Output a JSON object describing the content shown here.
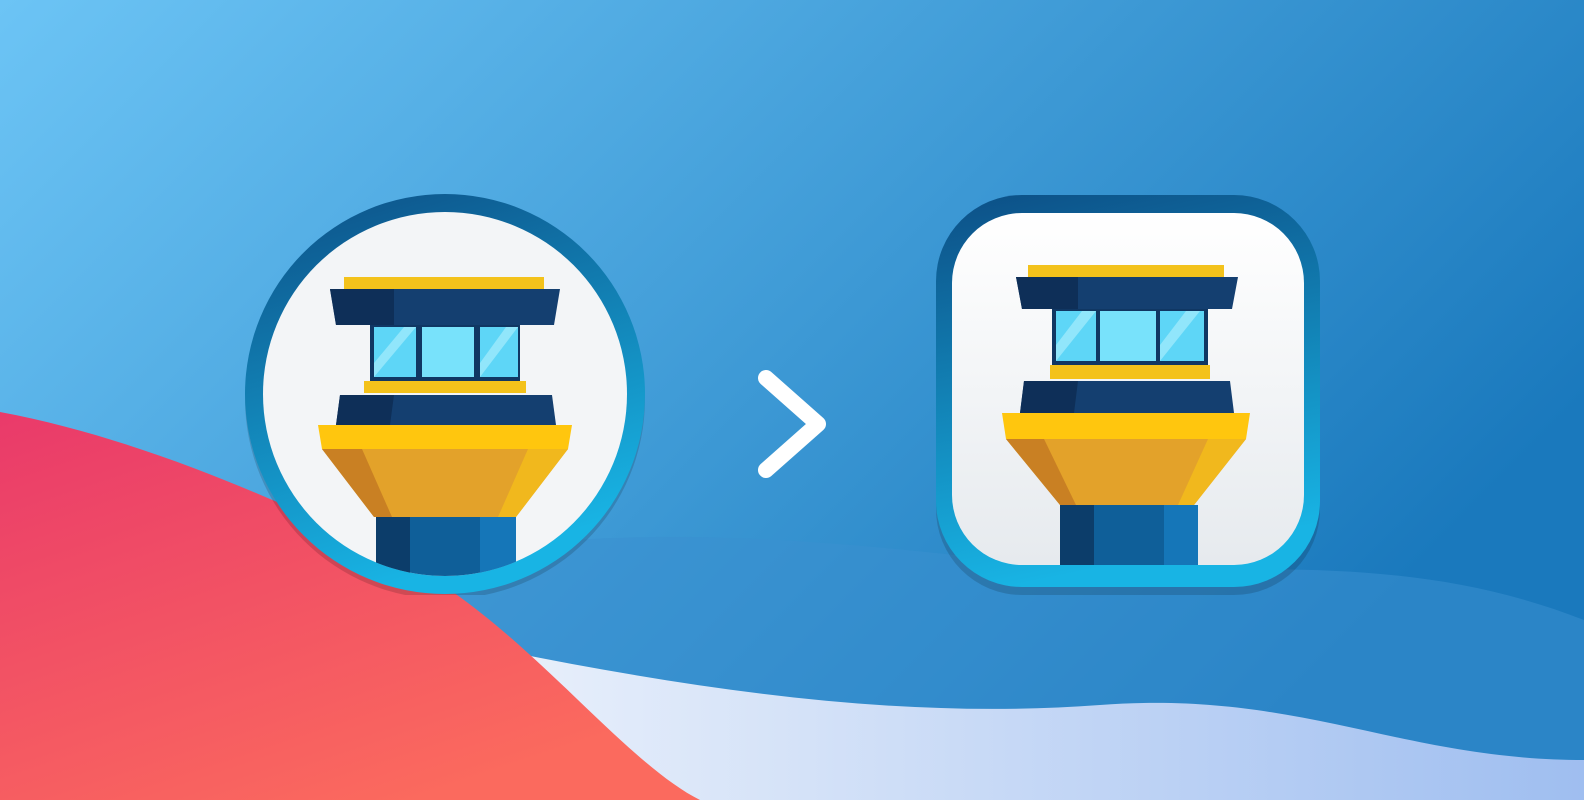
{
  "scene": {
    "background": {
      "gradient_start": "#6cc4f5",
      "gradient_end": "#1a79bd"
    },
    "wave_colors": {
      "red_start": "#e93a6a",
      "red_end": "#fb6a5e",
      "light_blue": "#c7d9f6",
      "mid_blue": "#3a8fd0"
    },
    "old_icon": {
      "name": "tower-icon-round",
      "shape": "circle",
      "ring_color": "#0f6aa2"
    },
    "arrow": {
      "name": "chevron-right-icon",
      "color": "#ffffff"
    },
    "new_icon": {
      "name": "tower-icon-squircle",
      "shape": "rounded-square",
      "ring_color": "#0f6aa2"
    },
    "palette": {
      "navy": "#123d6d",
      "gold": "#f0b81c",
      "glass": "#5fd2f5",
      "white": "#f3f5f7"
    }
  }
}
